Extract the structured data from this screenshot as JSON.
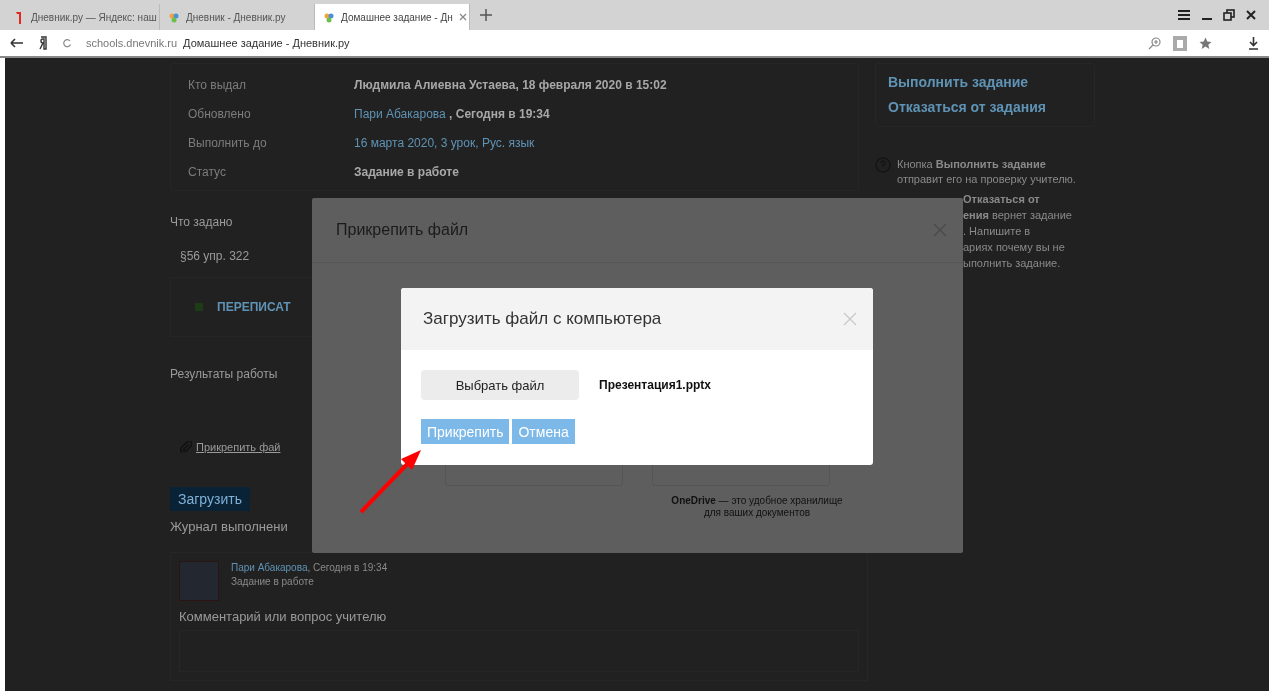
{
  "browser": {
    "tabs": [
      {
        "title": "Дневник.ру — Яндекс: наш",
        "selected": false
      },
      {
        "title": "Дневник - Дневник.ру",
        "selected": false
      },
      {
        "title": "Домашнее задание - Дн",
        "selected": true
      }
    ],
    "address": {
      "domain": "schools.dnevnik.ru",
      "title": "Домашнее задание - Дневник.ру"
    }
  },
  "page": {
    "info": [
      {
        "label": "Кто выдал",
        "parts": [
          {
            "text": "Людмила Алиевна Устаева, 18 февраля 2020 в 15:02",
            "kind": "bold"
          }
        ]
      },
      {
        "label": "Обновлено",
        "parts": [
          {
            "text": "Пари Абакарова",
            "kind": "link"
          },
          {
            "text": " , Сегодня в 19:34",
            "kind": "bold"
          }
        ]
      },
      {
        "label": "Выполнить до",
        "parts": [
          {
            "text": "16 марта 2020, 3 урок, Рус. язык",
            "kind": "link"
          }
        ]
      },
      {
        "label": "Статус",
        "parts": [
          {
            "text": "Задание в работе",
            "kind": "bold"
          }
        ]
      }
    ],
    "task_heading": "Что задано",
    "task_text": "§56 упр. 322",
    "task_action": "ПЕРЕПИСАТ",
    "results_heading": "Результаты работы",
    "attach_link": "Прикрепить фай",
    "upload_button": "Загрузить",
    "log_heading": "Журнал выполнени",
    "log_entry": {
      "author": "Пари Абакарова",
      "time": ", Сегодня в 19:34",
      "status": "Задание в работе"
    },
    "comment_label": "Комментарий или вопрос учителю",
    "actions": [
      "Выполнить задание",
      "Отказаться от задания"
    ],
    "help": [
      "Кнопка **Выполнить задание** отправит его на проверку учителю."
    ],
    "help_fragments": [
      "**Отказаться от**",
      "**ения** вернет задание",
      ". Напишите в",
      "ариях почему вы не",
      "ыполнить задание."
    ]
  },
  "attach_dialog": {
    "title": "Прикрепить файл",
    "note": "**OneDrive** — это удобное хранилище для ваших документов"
  },
  "upload_dialog": {
    "title": "Загрузить файл с компьютера",
    "choose_button": "Выбрать файл",
    "file_name": "Презентация1.pptx",
    "buttons": [
      "Прикрепить",
      "Отмена"
    ]
  }
}
